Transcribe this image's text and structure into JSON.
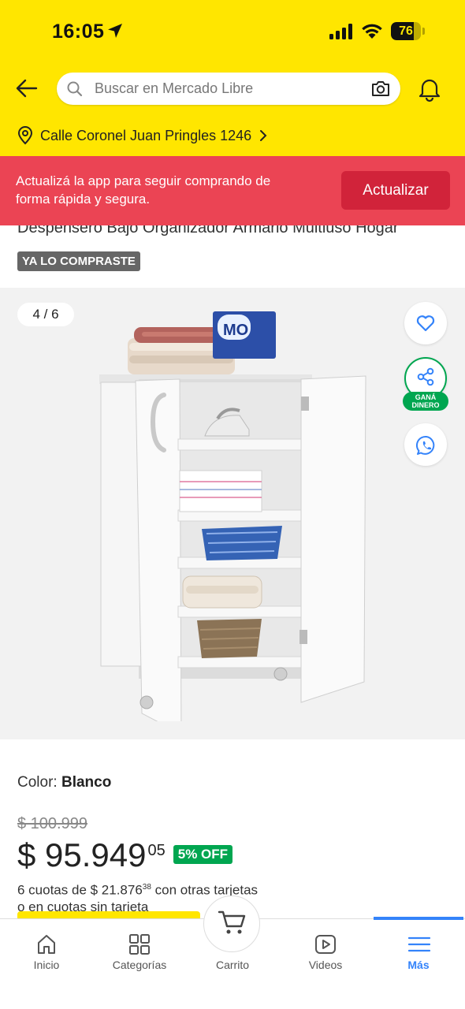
{
  "status_bar": {
    "time": "16:05",
    "battery": "76",
    "battery_level": 76
  },
  "search": {
    "placeholder": "Buscar en Mercado Libre"
  },
  "location": {
    "text": "Calle Coronel Juan Pringles 1246"
  },
  "update_banner": {
    "message": "Actualizá la app para seguir comprando de forma rápida y segura.",
    "button_label": "Actualizar"
  },
  "product": {
    "title": "Despensero Bajo Organizador Armario Multiuso Hogar",
    "bought_badge": "YA LO COMPRASTE",
    "gallery_counter": "4 / 6",
    "share_badge_line1": "GANÁ",
    "share_badge_line2": "DINERO",
    "color_label": "Color: ",
    "color_value": "Blanco",
    "old_price": "$ 100.999",
    "price": "$ 95.949",
    "price_cents": "05",
    "discount": "5% OFF",
    "installments_prefix": "6 cuotas de $ 21.876",
    "installments_cents": "38",
    "installments_suffix": " con otras tarjetas",
    "installments_line2": "o en cuotas sin tarjeta"
  },
  "tabbar": {
    "items": [
      {
        "label": "Inicio",
        "icon": "home-icon"
      },
      {
        "label": "Categorías",
        "icon": "categories-icon"
      },
      {
        "label": "Carrito",
        "icon": "cart-icon"
      },
      {
        "label": "Videos",
        "icon": "video-icon"
      },
      {
        "label": "Más",
        "icon": "menu-icon"
      }
    ],
    "active": "Más"
  },
  "colors": {
    "brand_yellow": "#FFE600",
    "banner_red": "#EB4454",
    "button_red": "#D1233A",
    "green": "#00A650",
    "blue": "#3483FA"
  }
}
